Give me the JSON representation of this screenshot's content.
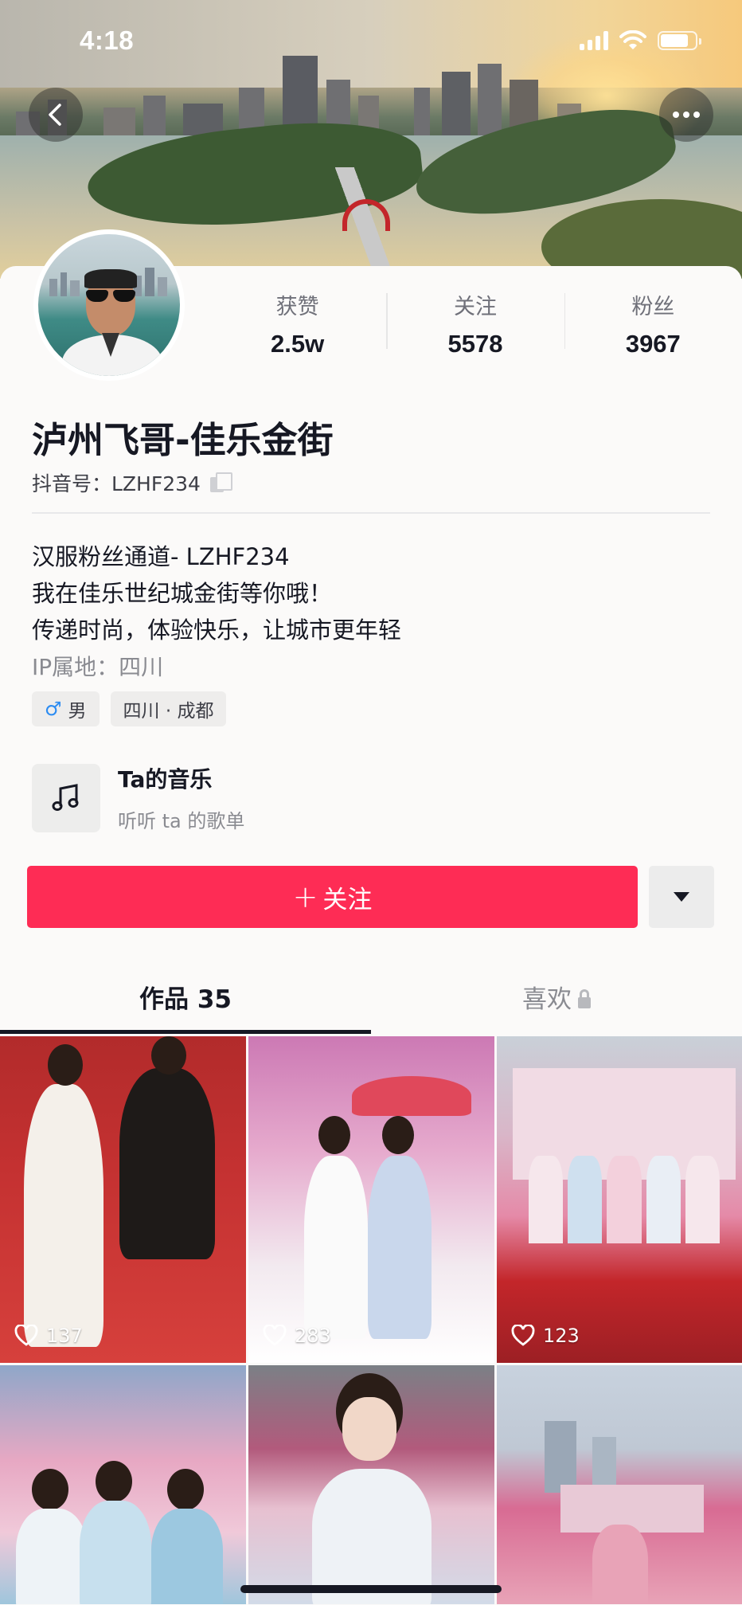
{
  "status_bar": {
    "time": "4:18"
  },
  "profile": {
    "stats": [
      {
        "label": "获赞",
        "value": "2.5w"
      },
      {
        "label": "关注",
        "value": "5578"
      },
      {
        "label": "粉丝",
        "value": "3967"
      }
    ],
    "nickname": "泸州飞哥-佳乐金街",
    "douyin_id": "抖音号：LZHF234",
    "bio_lines": [
      "汉服粉丝通道- LZHF234",
      "我在佳乐世纪城金街等你哦！",
      "传递时尚，体验快乐，让城市更年轻"
    ],
    "ip_location": "IP属地：四川",
    "tags": [
      {
        "icon": "male-icon",
        "label": "男"
      },
      {
        "label": "四川 · 成都"
      }
    ]
  },
  "music": {
    "title": "Ta的音乐",
    "subtitle": "听听 ta 的歌单"
  },
  "actions": {
    "follow_label": "关注",
    "dropdown_icon": "triangle-down-icon"
  },
  "tabs": [
    {
      "label": "作品 35",
      "active": true
    },
    {
      "label": "喜欢",
      "locked": true
    }
  ],
  "videos": [
    {
      "likes": "137"
    },
    {
      "likes": "283"
    },
    {
      "likes": "123"
    },
    {
      "likes": ""
    },
    {
      "likes": ""
    },
    {
      "likes": ""
    }
  ],
  "colors": {
    "accent": "#fe2c55",
    "text": "#161823",
    "muted": "#8a8b91"
  }
}
